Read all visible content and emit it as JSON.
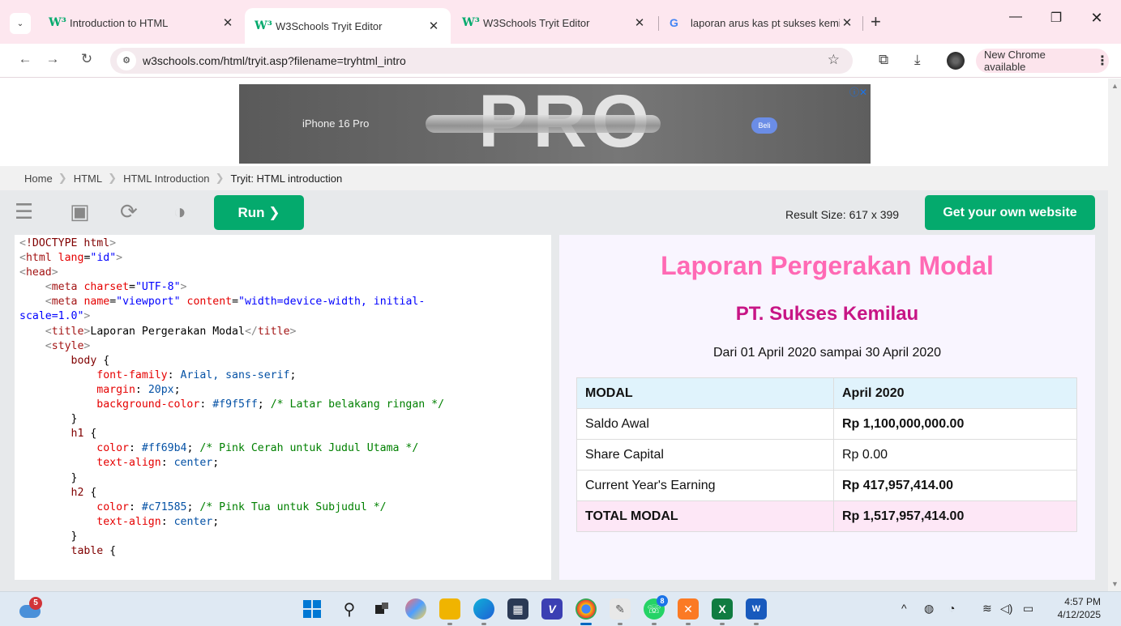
{
  "browser": {
    "tabs": [
      {
        "favicon": "W³",
        "title": "Introduction to HTML",
        "active": false
      },
      {
        "favicon": "W³",
        "title": "W3Schools Tryit Editor",
        "active": true
      },
      {
        "favicon": "W³",
        "title": "W3Schools Tryit Editor",
        "active": false
      },
      {
        "favicon": "G",
        "title": "laporan arus kas pt sukses kemi",
        "active": false
      }
    ],
    "url": "w3schools.com/html/tryit.asp?filename=tryhtml_intro",
    "update_label": "New Chrome available"
  },
  "ad": {
    "product": "iPhone 16 Pro",
    "big_text": "PRO",
    "button": "Beli"
  },
  "breadcrumb": [
    "Home",
    "HTML",
    "HTML Introduction",
    "Tryit: HTML introduction"
  ],
  "editor": {
    "run_label": "Run ❯",
    "result_size": "Result Size: 617 x 399",
    "get_website": "Get your own website"
  },
  "result": {
    "title": "Laporan Pergerakan Modal",
    "company": "PT. Sukses Kemilau",
    "period": "Dari 01 April 2020 sampai 30 April 2020",
    "table": {
      "headers": [
        "MODAL",
        "April 2020"
      ],
      "rows": [
        {
          "label": "Saldo Awal",
          "value": "Rp 1,100,000,000.00"
        },
        {
          "label": "Share Capital",
          "value": "Rp 0.00"
        },
        {
          "label": "Current Year's Earning",
          "value": "Rp 417,957,414.00"
        }
      ],
      "total": {
        "label": "TOTAL MODAL",
        "value": "Rp 1,517,957,414.00"
      }
    }
  },
  "taskbar": {
    "weather_badge": "5",
    "whatsapp_badge": "8",
    "time": "4:57 PM",
    "date": "4/12/2025"
  },
  "colors": {
    "accent_green": "#04aa6d",
    "h1_pink": "#ff69b4",
    "h2_pink": "#c71585",
    "result_bg": "#f9f5ff"
  }
}
